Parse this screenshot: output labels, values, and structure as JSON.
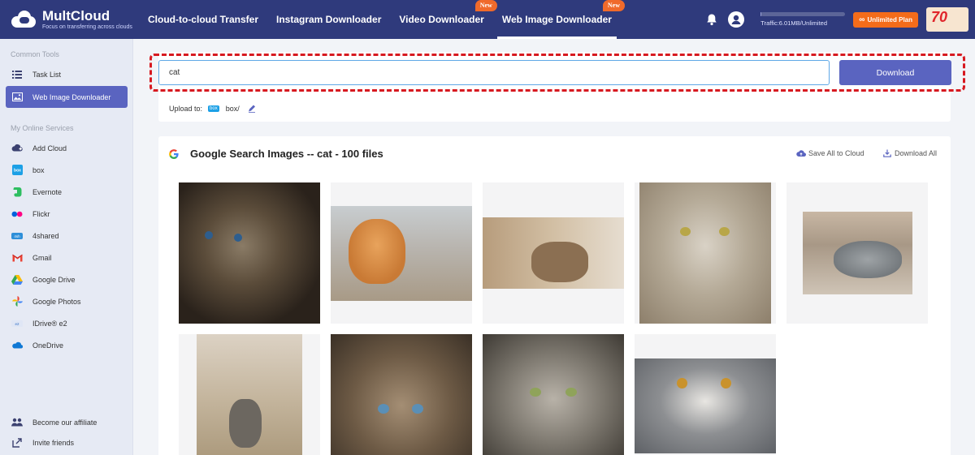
{
  "header": {
    "logo_name": "MultCloud",
    "logo_tagline": "Focus on transferring across clouds",
    "nav": [
      {
        "label": "Cloud-to-cloud Transfer",
        "badge": ""
      },
      {
        "label": "Instagram Downloader",
        "badge": ""
      },
      {
        "label": "Video Downloader",
        "badge": "New"
      },
      {
        "label": "Web Image Downloader",
        "badge": "New",
        "active": true
      }
    ],
    "traffic_text": "Traffic:6.01MB/Unlimited",
    "plan_label": "Unlimited Plan",
    "promo_text": "70"
  },
  "sidebar": {
    "common_title": "Common Tools",
    "common_items": [
      {
        "label": "Task List",
        "icon": "list-icon"
      },
      {
        "label": "Web Image Downloader",
        "icon": "image-icon",
        "active": true
      }
    ],
    "services_title": "My Online Services",
    "services": [
      {
        "label": "Add Cloud",
        "icon": "add-cloud-icon"
      },
      {
        "label": "box",
        "icon": "box-icon"
      },
      {
        "label": "Evernote",
        "icon": "evernote-icon"
      },
      {
        "label": "Flickr",
        "icon": "flickr-icon"
      },
      {
        "label": "4shared",
        "icon": "4shared-icon"
      },
      {
        "label": "Gmail",
        "icon": "gmail-icon"
      },
      {
        "label": "Google Drive",
        "icon": "google-drive-icon"
      },
      {
        "label": "Google Photos",
        "icon": "google-photos-icon"
      },
      {
        "label": "IDrive® e2",
        "icon": "idrive-icon"
      },
      {
        "label": "OneDrive",
        "icon": "onedrive-icon"
      }
    ],
    "bottom_items": [
      {
        "label": "Become our affiliate",
        "icon": "affiliate-icon"
      },
      {
        "label": "Invite friends",
        "icon": "invite-icon"
      }
    ]
  },
  "search": {
    "value": "cat",
    "download_label": "Download",
    "upload_label": "Upload to:",
    "upload_badge": "box",
    "upload_path": "box/"
  },
  "results": {
    "title": "Google Search Images -- cat - 100 files",
    "save_all_label": "Save All to Cloud",
    "download_all_label": "Download All"
  },
  "colors": {
    "header_bg": "#2f3a7c",
    "accent": "#5a64c0",
    "badge": "#f06a2b",
    "highlight": "#d71920"
  }
}
